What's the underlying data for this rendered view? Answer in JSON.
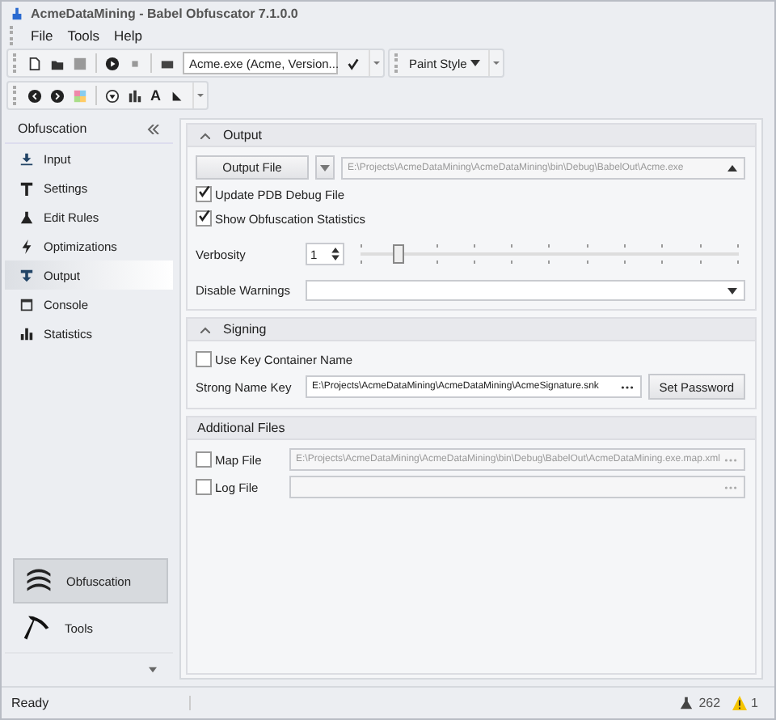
{
  "window": {
    "title": "AcmeDataMining - Babel Obfuscator 7.1.0.0"
  },
  "menu": [
    "File",
    "Tools",
    "Help"
  ],
  "toolbar": {
    "assembly": "Acme.exe (Acme, Version...",
    "paint_style": "Paint Style",
    "font_glyph": "A"
  },
  "sidebar": {
    "header": "Obfuscation",
    "items": [
      {
        "label": "Input",
        "selected": false
      },
      {
        "label": "Settings",
        "selected": false
      },
      {
        "label": "Edit Rules",
        "selected": false
      },
      {
        "label": "Optimizations",
        "selected": false
      },
      {
        "label": "Output",
        "selected": true
      },
      {
        "label": "Console",
        "selected": false
      },
      {
        "label": "Statistics",
        "selected": false
      }
    ],
    "nav": [
      {
        "label": "Obfuscation",
        "selected": true
      },
      {
        "label": "Tools",
        "selected": false
      }
    ]
  },
  "output": {
    "title": "Output",
    "expanded": true,
    "file_button": "Output File",
    "path": "E:\\Projects\\AcmeDataMining\\AcmeDataMining\\bin\\Debug\\BabelOut\\Acme.exe",
    "options": [
      {
        "label": "Update PDB Debug File",
        "checked": true
      },
      {
        "label": "Show Obfuscation Statistics",
        "checked": true
      }
    ],
    "verbosity_label": "Verbosity",
    "verbosity": "1",
    "level": 0.1,
    "warnings_label": "Disable Warnings"
  },
  "signing": {
    "title": "Signing",
    "expanded": true,
    "use_container": {
      "label": "Use Key Container Name",
      "checked": false
    },
    "key_label": "Strong Name Key",
    "key_path": "E:\\Projects\\AcmeDataMining\\AcmeDataMining\\AcmeSignature.snk",
    "password_button": "Set Password"
  },
  "additional": {
    "title": "Additional Files",
    "files": [
      {
        "label": "Map File",
        "checked": false,
        "path": "E:\\Projects\\AcmeDataMining\\AcmeDataMining\\bin\\Debug\\BabelOut\\AcmeDataMining.exe.map.xml"
      },
      {
        "label": "Log File",
        "checked": false
      }
    ]
  },
  "status_bar": {
    "text": "Ready",
    "rules_count": "262",
    "warnings_count": "1"
  }
}
